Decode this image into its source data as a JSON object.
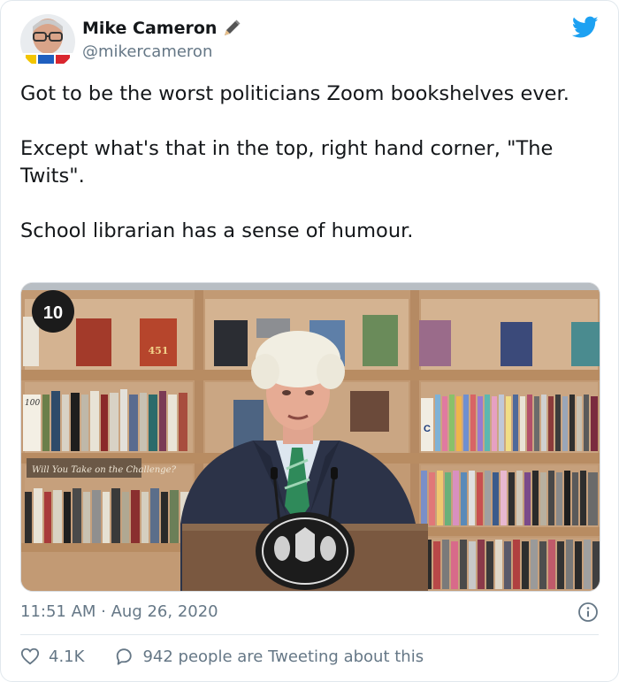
{
  "author": {
    "display_name": "Mike Cameron",
    "handle": "@mikercameron"
  },
  "tweet": {
    "paragraphs": [
      "Got to be the worst politicians Zoom bookshelves ever.",
      "Except what's that in the top, right hand corner, \"The Twits\".",
      "School librarian has a sense of humour."
    ],
    "timestamp": "11:51 AM · Aug 26, 2020",
    "likes": "4.1K",
    "replies_text": "942 people are Tweeting about this"
  },
  "media": {
    "channel_badge": "10",
    "book_numbers": {
      "fahrenheit": "451",
      "spine_100": "100",
      "shelf_letter": "C"
    },
    "shelf_sign": "Will You Take on the Challenge?"
  },
  "colors": {
    "twitter_blue": "#1da1f2",
    "text_primary": "#14171a",
    "text_secondary": "#657786",
    "border": "#e1e8ed"
  },
  "icons": [
    "pen-icon",
    "twitter-bird-icon",
    "info-icon",
    "heart-icon",
    "reply-icon"
  ]
}
